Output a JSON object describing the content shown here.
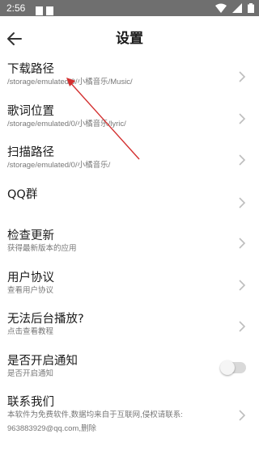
{
  "status_bar": {
    "time": "2:56"
  },
  "header": {
    "title": "设置"
  },
  "settings": [
    {
      "title": "下载路径",
      "subtitle": "/storage/emulated/0/小橘音乐/Music/"
    },
    {
      "title": "歌词位置",
      "subtitle": "/storage/emulated/0/小橘音乐/lyric/"
    },
    {
      "title": "扫描路径",
      "subtitle": "/storage/emulated/0/小橘音乐/"
    },
    {
      "title": "QQ群",
      "subtitle": ""
    },
    {
      "title": "检查更新",
      "subtitle": "获得最新版本的应用"
    },
    {
      "title": "用户协议",
      "subtitle": "查看用户协议"
    },
    {
      "title": "无法后台播放?",
      "subtitle": "点击查看教程"
    },
    {
      "title": "是否开启通知",
      "subtitle": "是否开启通知",
      "toggle_on": false
    },
    {
      "title": "联系我们",
      "subtitle": "本软件为免费软件,数据均来自于互联网,侵权请联系:",
      "subtitle_line2": "963883929@qq.com,删除"
    }
  ],
  "colors": {
    "status_bar": "#6f6f6f",
    "annotation_arrow": "#d32f2f"
  }
}
